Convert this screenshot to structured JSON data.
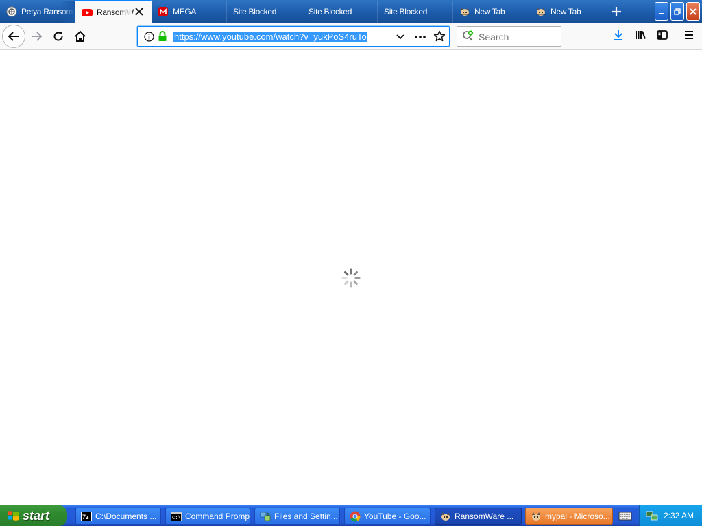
{
  "browser": {
    "tabs": [
      {
        "label": "Petya Ransom",
        "icon": "shield-icon",
        "active": false
      },
      {
        "label": "RansomW",
        "icon": "youtube-icon",
        "active": true
      },
      {
        "label": "MEGA",
        "icon": "mega-icon",
        "active": false
      },
      {
        "label": "Site Blocked",
        "icon": "none",
        "active": false
      },
      {
        "label": "Site Blocked",
        "icon": "none",
        "active": false
      },
      {
        "label": "Site Blocked",
        "icon": "none",
        "active": false
      },
      {
        "label": "New Tab",
        "icon": "cat-icon",
        "active": false
      },
      {
        "label": "New Tab",
        "icon": "cat-icon",
        "active": false
      }
    ],
    "address": {
      "url": "https://www.youtube.com/watch?v=yukPoS4ruTo"
    },
    "search": {
      "placeholder": "Search"
    },
    "accent": "#0a84ff"
  },
  "content": {
    "state": "loading"
  },
  "taskbar": {
    "start_label": "start",
    "tasks": [
      {
        "label": "C:\\Documents ...",
        "icon": "7zip-icon"
      },
      {
        "label": "Command Prompt",
        "icon": "cmd-icon"
      },
      {
        "label": "Files and Settin...",
        "icon": "transfer-icon"
      },
      {
        "label": "YouTube - Goo...",
        "icon": "chrome-icon"
      },
      {
        "label": "RansomWare ...",
        "icon": "cat-icon"
      },
      {
        "label": "mypal - Microso...",
        "icon": "cat-icon"
      }
    ],
    "clock": "2:32 AM"
  }
}
